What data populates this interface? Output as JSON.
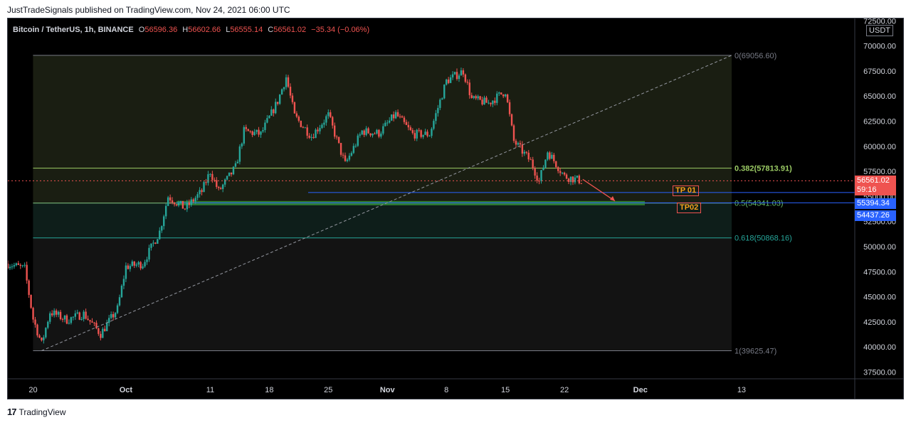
{
  "header": {
    "publisher_line": "JustTradeSignals published on TradingView.com, Nov 24, 2021 06:00 UTC"
  },
  "legend": {
    "symbol": "Bitcoin / TetherUS, 1h, BINANCE",
    "open_label": "O",
    "open": "56596.36",
    "high_label": "H",
    "high": "56602.66",
    "low_label": "L",
    "low": "56555.14",
    "close_label": "C",
    "close": "56561.02",
    "change": "−35.34 (−0.06%)"
  },
  "currency": "USDT",
  "price_tags": {
    "last_price": "56561.02",
    "countdown": "59:16",
    "blue_1": "55394.34",
    "blue_2": "54437.26"
  },
  "targets": {
    "tp1": "TP 01",
    "tp2": "TP02"
  },
  "footer": {
    "brand": "TradingView"
  },
  "colors": {
    "background": "#000000",
    "up": "#26a69a",
    "down": "#ef5350",
    "fib_upper_fill": "#1a1e12",
    "fib_mid_fill": "#0e1e1a",
    "fib_lower_fill": "#131313",
    "tp_line": "#2962ff",
    "target_zone": "#2e7d32"
  },
  "chart_data": {
    "type": "candlestick",
    "title": "Bitcoin / TetherUS, 1h, BINANCE",
    "ylim": [
      36500,
      73000
    ],
    "y_ticks": [
      37500,
      40000,
      42500,
      45000,
      47500,
      50000,
      52500,
      55000,
      57500,
      60000,
      62500,
      65000,
      67500,
      70000,
      72500
    ],
    "y_tick_labels": [
      "37500.00",
      "40000.00",
      "42500.00",
      "45000.00",
      "47500.00",
      "50000.00",
      "52500.00",
      "55000.00",
      "57500.00",
      "60000.00",
      "62500.00",
      "65000.00",
      "67500.00",
      "70000.00",
      "72500.00"
    ],
    "x_labels": [
      "20",
      "Oct",
      "11",
      "18",
      "25",
      "Nov",
      "8",
      "15",
      "22",
      "Dec",
      "13"
    ],
    "price_path": [
      {
        "t": "2021-09-17",
        "p": 48300
      },
      {
        "t": "2021-09-19",
        "p": 47800
      },
      {
        "t": "2021-09-20",
        "p": 42800
      },
      {
        "t": "2021-09-21",
        "p": 40300
      },
      {
        "t": "2021-09-22",
        "p": 43500
      },
      {
        "t": "2021-09-24",
        "p": 42700
      },
      {
        "t": "2021-09-26",
        "p": 43300
      },
      {
        "t": "2021-09-28",
        "p": 41300
      },
      {
        "t": "2021-09-30",
        "p": 43800
      },
      {
        "t": "2021-10-01",
        "p": 48000
      },
      {
        "t": "2021-10-03",
        "p": 48300
      },
      {
        "t": "2021-10-05",
        "p": 51500
      },
      {
        "t": "2021-10-06",
        "p": 55000
      },
      {
        "t": "2021-10-08",
        "p": 53800
      },
      {
        "t": "2021-10-10",
        "p": 55500
      },
      {
        "t": "2021-10-11",
        "p": 57500
      },
      {
        "t": "2021-10-12",
        "p": 55500
      },
      {
        "t": "2021-10-14",
        "p": 57900
      },
      {
        "t": "2021-10-15",
        "p": 61500
      },
      {
        "t": "2021-10-17",
        "p": 61200
      },
      {
        "t": "2021-10-19",
        "p": 64500
      },
      {
        "t": "2021-10-20",
        "p": 66900
      },
      {
        "t": "2021-10-21",
        "p": 63000
      },
      {
        "t": "2021-10-23",
        "p": 61000
      },
      {
        "t": "2021-10-25",
        "p": 63100
      },
      {
        "t": "2021-10-27",
        "p": 58200
      },
      {
        "t": "2021-10-29",
        "p": 61500
      },
      {
        "t": "2021-10-31",
        "p": 61300
      },
      {
        "t": "2021-11-02",
        "p": 63200
      },
      {
        "t": "2021-11-04",
        "p": 61200
      },
      {
        "t": "2021-11-06",
        "p": 61200
      },
      {
        "t": "2021-11-08",
        "p": 66500
      },
      {
        "t": "2021-11-10",
        "p": 67500
      },
      {
        "t": "2021-11-11",
        "p": 64700
      },
      {
        "t": "2021-11-13",
        "p": 64300
      },
      {
        "t": "2021-11-15",
        "p": 65500
      },
      {
        "t": "2021-11-16",
        "p": 60500
      },
      {
        "t": "2021-11-18",
        "p": 58500
      },
      {
        "t": "2021-11-19",
        "p": 56500
      },
      {
        "t": "2021-11-20",
        "p": 59500
      },
      {
        "t": "2021-11-22",
        "p": 57000
      },
      {
        "t": "2021-11-24",
        "p": 56561
      }
    ],
    "fib_retracement": {
      "start": {
        "t": "2021-09-21",
        "p": 39625.47
      },
      "end": {
        "t": "2021-11-10",
        "p": 69056.6
      },
      "levels": [
        {
          "ratio": "0",
          "price": 69056.6,
          "label": "0(69056.60)"
        },
        {
          "ratio": "0.382",
          "price": 57813.91,
          "label": "0.382(57813.91)"
        },
        {
          "ratio": "0.5",
          "price": 54341.03,
          "label": "0.5(54341.03)"
        },
        {
          "ratio": "0.618",
          "price": 50868.16,
          "label": "0.618(50868.16)"
        },
        {
          "ratio": "1",
          "price": 39625.47,
          "label": "1(39625.47)"
        }
      ]
    },
    "target_lines": [
      {
        "name": "TP 01",
        "price": 55394.34
      },
      {
        "name": "TP02",
        "price": 54437.26
      }
    ],
    "current_price": 56561.02
  }
}
